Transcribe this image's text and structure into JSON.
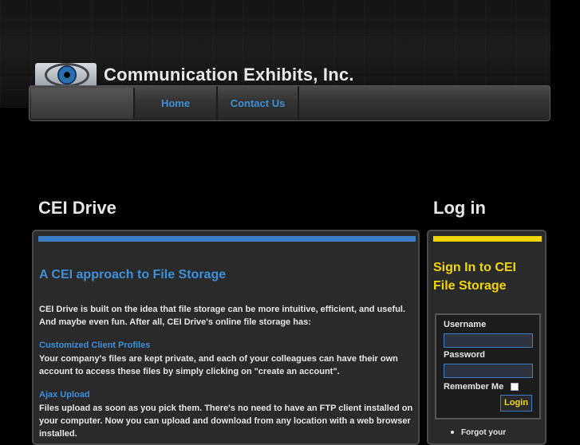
{
  "header": {
    "site_title": "Communication Exhibits, Inc."
  },
  "nav": {
    "items": [
      {
        "label": "Home"
      },
      {
        "label": "Contact Us"
      }
    ]
  },
  "main": {
    "heading": "CEI Drive",
    "title": "A CEI approach to File Storage",
    "intro": "CEI Drive is built on the idea that file storage can be more intuitive, efficient, and useful. And maybe even fun. After all, CEI Drive's online file storage has:",
    "sections": [
      {
        "title": "Customized Client Profiles",
        "text": "Your company's files are kept private, and each of your colleagues can have their own account to access these files by simply clicking on \"create an account\"."
      },
      {
        "title": "Ajax Upload",
        "text": "Files upload as soon as you pick them. There's no need to have an FTP client installed on your computer. Now you can upload and download from any location with a web browser installed."
      }
    ]
  },
  "sidebar": {
    "heading": "Log in",
    "title": "Sign In to CEI File Storage",
    "username_label": "Username",
    "username_value": "",
    "password_label": "Password",
    "password_value": "",
    "remember_label": "Remember Me",
    "login_button": "Login",
    "forgot_link": "Forgot your"
  },
  "colors": {
    "accent_blue": "#3d8fd9",
    "accent_yellow": "#f2d600",
    "panel_bg": "#2a2a2a"
  }
}
